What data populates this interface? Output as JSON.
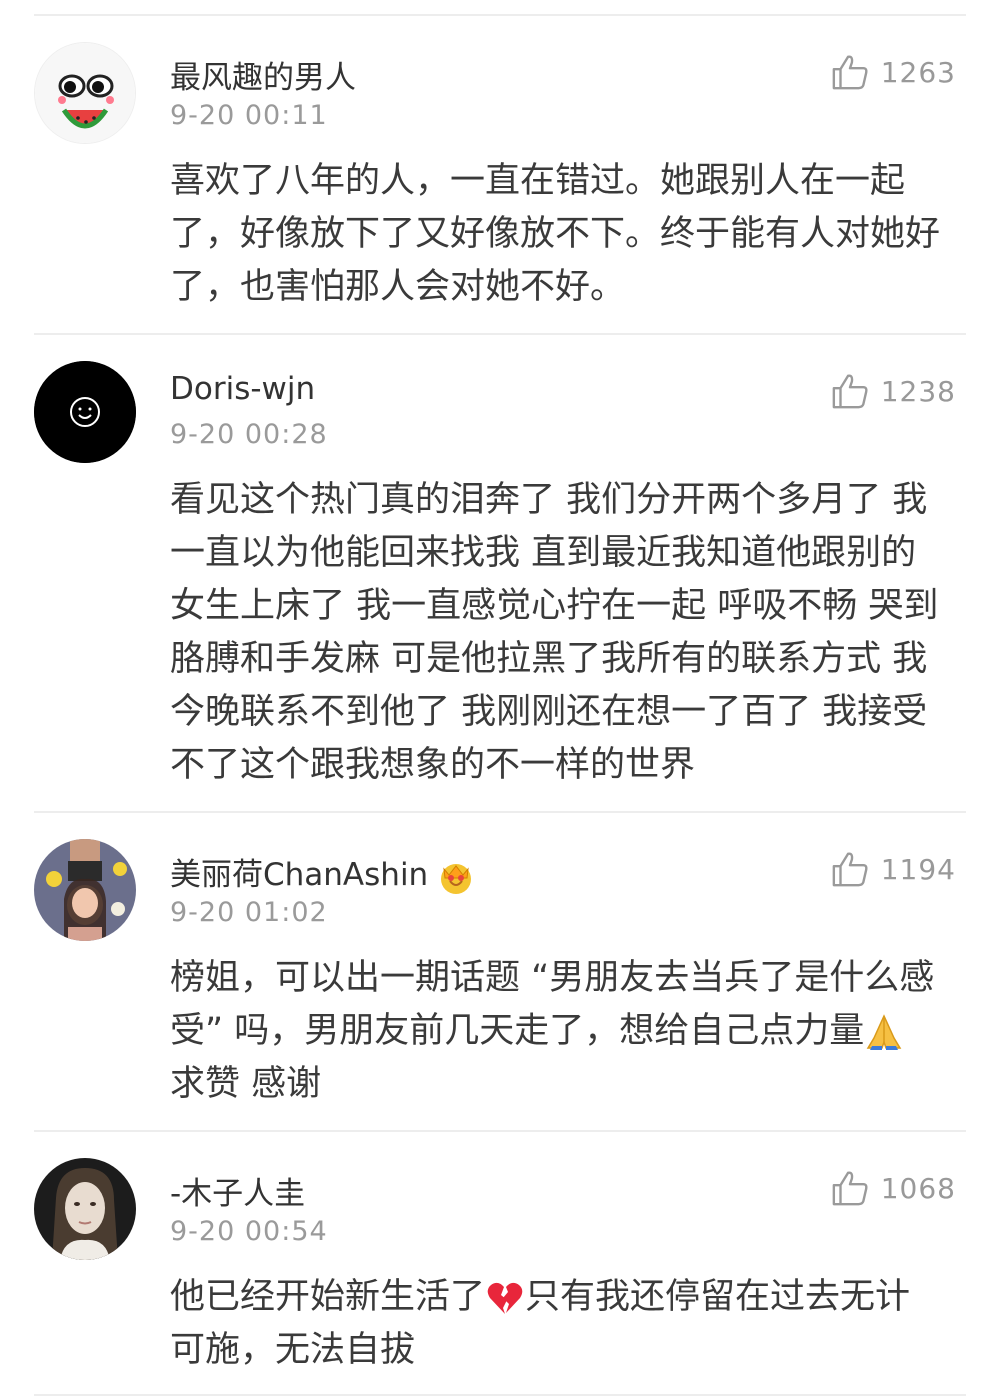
{
  "comments": [
    {
      "username": "最风趣的男人",
      "time": "9-20 00:11",
      "likes": "1263",
      "lines": [
        "喜欢了八年的人，一直在错过。她跟别人在一起",
        "了，好像放下了又好像放不下。终于能有人对她好",
        "了，也害怕那人会对她不好。"
      ]
    },
    {
      "username": "Doris-wjn",
      "time": "9-20 00:28",
      "likes": "1238",
      "lines": [
        "看见这个热门真的泪奔了 我们分开两个多月了 我",
        "一直以为他能回来找我 直到最近我知道他跟别的",
        "女生上床了 我一直感觉心拧在一起 呼吸不畅 哭到",
        "胳膊和手发麻 可是他拉黑了我所有的联系方式 我",
        "今晚联系不到他了 我刚刚还在想一了百了 我接受",
        "不了这个跟我想象的不一样的世界"
      ]
    },
    {
      "username": "美丽荷ChanAshin",
      "time": "9-20 01:02",
      "likes": "1194",
      "lines": [
        "榜姐，可以出一期话题 “男朋友去当兵了是什么感",
        "受” 吗，男朋友前几天走了，想给自己点力量",
        "求赞 感谢"
      ]
    },
    {
      "username": "-木子人圭",
      "time": "9-20 00:54",
      "likes": "1068",
      "line1_a": "他已经开始新生活了",
      "line1_b": "只有我还停留在过去无计",
      "line2": "可施，无法自拔"
    }
  ]
}
